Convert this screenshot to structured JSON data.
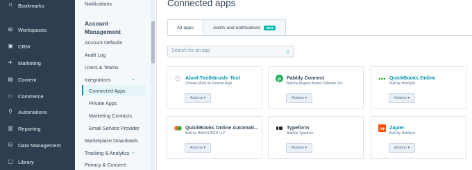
{
  "nav": {
    "items": [
      {
        "label": "Bookmarks",
        "icon": "bookmark-icon",
        "glyph": "⌑"
      },
      {
        "label": "Workspaces",
        "icon": "workspaces-icon",
        "glyph": "⊞"
      },
      {
        "label": "CRM",
        "icon": "crm-icon",
        "glyph": "▣"
      },
      {
        "label": "Marketing",
        "icon": "marketing-icon",
        "glyph": "✈"
      },
      {
        "label": "Content",
        "icon": "content-icon",
        "glyph": "▤"
      },
      {
        "label": "Commerce",
        "icon": "commerce-icon",
        "glyph": "▭"
      },
      {
        "label": "Automations",
        "icon": "automations-icon",
        "glyph": "⚲"
      },
      {
        "label": "Reporting",
        "icon": "reporting-icon",
        "glyph": "▥"
      },
      {
        "label": "Data Management",
        "icon": "data-management-icon",
        "glyph": "⛁"
      },
      {
        "label": "Library",
        "icon": "library-icon",
        "glyph": "▢"
      }
    ]
  },
  "sidebar": {
    "notifications": "Notifications",
    "section_title": "Account Management",
    "account_defaults": "Account Defaults",
    "audit_log": "Audit Log",
    "users_teams": "Users & Teams",
    "integrations": "Integrations",
    "connected_apps": "Connected Apps",
    "private_apps": "Private Apps",
    "marketing_contacts": "Marketing Contacts",
    "email_service_provider": "Email Service Provider",
    "marketplace_downloads": "Marketplace Downloads",
    "tracking_analytics": "Tracking & Analytics",
    "privacy_consent": "Privacy & Consent"
  },
  "main": {
    "title": "Connected apps",
    "tabs": [
      {
        "label": "All apps"
      },
      {
        "label": "Alerts and notifications",
        "badge": "NEW"
      }
    ],
    "search_placeholder": "Search for an app",
    "apps": [
      {
        "name": "Aloof-Toothbrush- Test",
        "by": "(Private) Built by Komran Rojo",
        "actions": "Actions ▾"
      },
      {
        "name": "Pabbly Connect",
        "by": "Built by Magnet Brains Software Tec...",
        "actions": "Actions ▾"
      },
      {
        "name": "QuickBooks Online",
        "by": "Built by HubSpot",
        "actions": "Actions ▾"
      },
      {
        "name": "QuickBooks Online Automati...",
        "by": "Built by HelloCODER LLP",
        "actions": "Actions ▾"
      },
      {
        "name": "Typeform",
        "by": "Built by Typeform",
        "actions": "Actions ▾"
      },
      {
        "name": "Zapier",
        "by": "Built by HubSpot",
        "actions": "Actions ▾"
      }
    ]
  },
  "colors": {
    "accent": "#0091ae",
    "nav_bg": "#2d3e50",
    "badge": "#00bda5",
    "zapier": "#ff4a00",
    "pabbly": "#20b05a"
  }
}
